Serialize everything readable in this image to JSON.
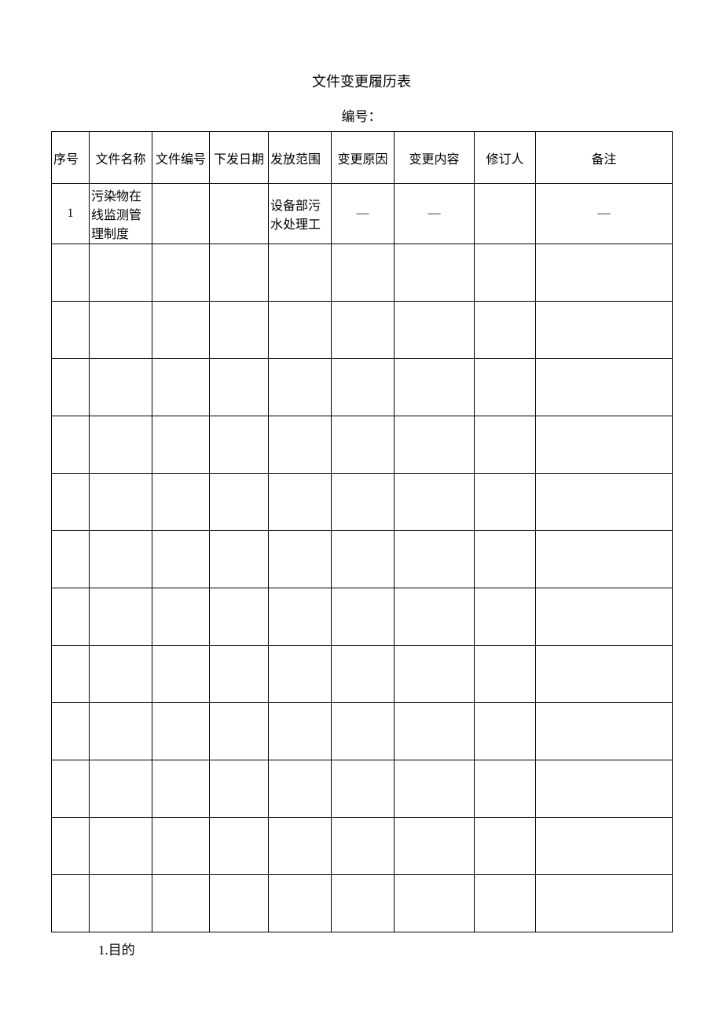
{
  "document": {
    "title": "文件变更履历表",
    "subtitle": "编号：",
    "footer_note": "1.目的"
  },
  "table": {
    "headers": [
      "序号",
      "文件名称",
      "文件编号",
      "下发日期",
      "发放范围",
      "变更原因",
      "变更内容",
      "修订人",
      "备注"
    ],
    "rows": [
      {
        "seq": "1",
        "file_name": "污染物在线监测管理制度",
        "file_number": "",
        "issue_date": "",
        "scope": "设备部污水处理工",
        "change_reason": "—",
        "change_content": "—",
        "reviser": "",
        "remark": "—"
      },
      {
        "seq": "",
        "file_name": "",
        "file_number": "",
        "issue_date": "",
        "scope": "",
        "change_reason": "",
        "change_content": "",
        "reviser": "",
        "remark": ""
      },
      {
        "seq": "",
        "file_name": "",
        "file_number": "",
        "issue_date": "",
        "scope": "",
        "change_reason": "",
        "change_content": "",
        "reviser": "",
        "remark": ""
      },
      {
        "seq": "",
        "file_name": "",
        "file_number": "",
        "issue_date": "",
        "scope": "",
        "change_reason": "",
        "change_content": "",
        "reviser": "",
        "remark": ""
      },
      {
        "seq": "",
        "file_name": "",
        "file_number": "",
        "issue_date": "",
        "scope": "",
        "change_reason": "",
        "change_content": "",
        "reviser": "",
        "remark": ""
      },
      {
        "seq": "",
        "file_name": "",
        "file_number": "",
        "issue_date": "",
        "scope": "",
        "change_reason": "",
        "change_content": "",
        "reviser": "",
        "remark": ""
      },
      {
        "seq": "",
        "file_name": "",
        "file_number": "",
        "issue_date": "",
        "scope": "",
        "change_reason": "",
        "change_content": "",
        "reviser": "",
        "remark": ""
      },
      {
        "seq": "",
        "file_name": "",
        "file_number": "",
        "issue_date": "",
        "scope": "",
        "change_reason": "",
        "change_content": "",
        "reviser": "",
        "remark": ""
      },
      {
        "seq": "",
        "file_name": "",
        "file_number": "",
        "issue_date": "",
        "scope": "",
        "change_reason": "",
        "change_content": "",
        "reviser": "",
        "remark": ""
      },
      {
        "seq": "",
        "file_name": "",
        "file_number": "",
        "issue_date": "",
        "scope": "",
        "change_reason": "",
        "change_content": "",
        "reviser": "",
        "remark": ""
      },
      {
        "seq": "",
        "file_name": "",
        "file_number": "",
        "issue_date": "",
        "scope": "",
        "change_reason": "",
        "change_content": "",
        "reviser": "",
        "remark": ""
      },
      {
        "seq": "",
        "file_name": "",
        "file_number": "",
        "issue_date": "",
        "scope": "",
        "change_reason": "",
        "change_content": "",
        "reviser": "",
        "remark": ""
      },
      {
        "seq": "",
        "file_name": "",
        "file_number": "",
        "issue_date": "",
        "scope": "",
        "change_reason": "",
        "change_content": "",
        "reviser": "",
        "remark": ""
      }
    ]
  }
}
